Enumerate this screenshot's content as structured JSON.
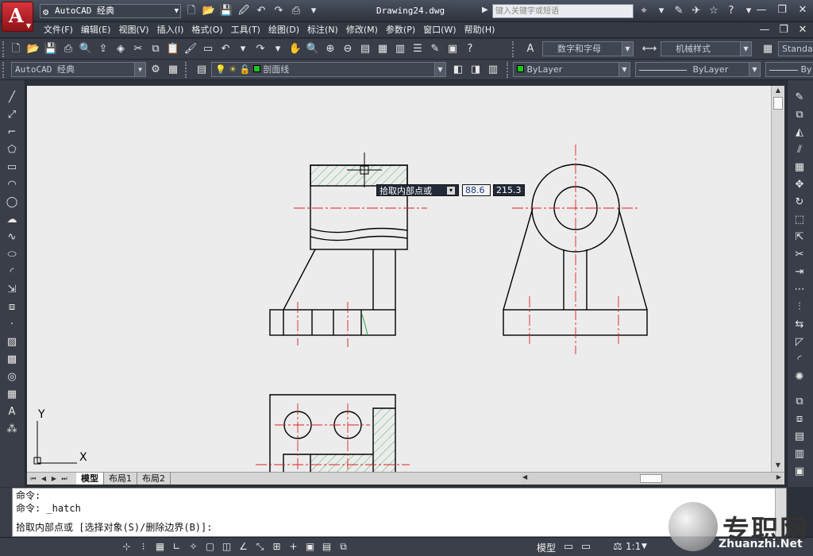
{
  "title_bar": {
    "workspace": "AutoCAD 经典",
    "document_title": "Drawing24.dwg",
    "search_placeholder": "键入关键字或短语"
  },
  "menu": [
    "文件(F)",
    "编辑(E)",
    "视图(V)",
    "插入(I)",
    "格式(O)",
    "工具(T)",
    "绘图(D)",
    "标注(N)",
    "修改(M)",
    "参数(P)",
    "窗口(W)",
    "帮助(H)"
  ],
  "toolbar1": {
    "text_style": "数字和字母",
    "dim_style": "机械样式",
    "table_style": "Standa"
  },
  "toolbar2": {
    "workspace": "AutoCAD 经典",
    "layer": "剖面线",
    "color": "ByLayer",
    "linetype": "ByLayer",
    "lineweight": "By"
  },
  "tabs": [
    "模型",
    "布局1",
    "布局2"
  ],
  "dynamic_input": {
    "prompt": "拾取内部点或",
    "value_x": "88.6",
    "value_y": "215.3"
  },
  "ucs": {
    "y_label": "Y",
    "x_label": "X"
  },
  "command_lines": [
    "命令:",
    "命令: _hatch",
    "拾取内部点或 [选择对象(S)/删除边界(B)]:"
  ],
  "status": {
    "model_label": "模型",
    "scale": "1:1"
  },
  "watermark": {
    "text": "专职网",
    "url": "Zhuanzhi.Net"
  }
}
